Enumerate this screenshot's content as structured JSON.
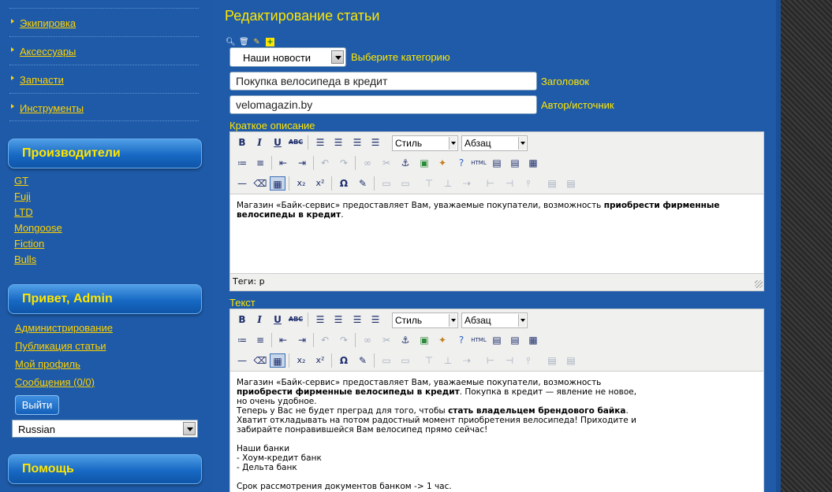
{
  "sidebar": {
    "categories": [
      "Экипировка",
      "Аксессуары",
      "Запчасти",
      "Инструменты"
    ],
    "makers_title": "Производители",
    "makers": [
      "GT",
      "Fuji",
      "LTD",
      "Mongoose",
      "Fiction",
      "Bulls"
    ],
    "greeting": "Привет, Admin",
    "admin_links": [
      "Администрирование",
      "Публикация статьи",
      "Мой профиль",
      "Сообщения (0/0)"
    ],
    "logout_label": "Выйти",
    "language": "Russian",
    "help_title": "Помощь"
  },
  "main": {
    "title": "Редактирование статьи",
    "category_value": "Наши новости",
    "category_label": "Выберите категорию",
    "headline_value": "Покупка велосипеда в кредит",
    "headline_label": "Заголовок",
    "author_value": "velomagazin.by",
    "author_label": "Автор/источник",
    "short_label": "Краткое описание",
    "text_label": "Текст",
    "style_select": "Стиль",
    "format_select": "Абзац",
    "status_tags": "Теги: p",
    "short_text_plain": "Магазин «Байк-сервис» предоставляет Вам, уважаемые покупатели, возможность ",
    "short_text_bold": "приобрести фирменные велосипеды в кредит",
    "short_text_end": ".",
    "body": {
      "p1_a": "Магазин «Байк-сервис» предоставляет Вам, уважаемые покупатели, возможность ",
      "p1_b": "приобрести фирменные велосипеды в кредит",
      "p1_c": ". Покупка в кредит — явление не новое, но очень удобное.",
      "p2_a": "Теперь у Вас не будет преград для того, чтобы ",
      "p2_b": "стать владельцем брендового байка",
      "p2_c": ".",
      "p3": "Хватит откладывать на потом радостный момент приобретения велосипеда! Приходите и забирайте понравившейся Вам велосипед прямо сейчас!",
      "banks_title": "Наши банки",
      "bank1": "- Хоум-кредит банк",
      "bank2": "- Дельта банк",
      "term": "Срок рассмотрения документов банком -> 1 час."
    }
  },
  "colors": {
    "background": "#1f5ba8",
    "accent": "#ffe600",
    "link": "#ffd200"
  },
  "icons": [
    "search-icon",
    "trash-icon",
    "pencil-icon",
    "add-icon",
    "bold-icon",
    "italic-icon",
    "underline-icon",
    "strike-icon",
    "align-left-icon",
    "align-center-icon",
    "align-right-icon",
    "justify-icon",
    "bullet-list-icon",
    "number-list-icon",
    "outdent-icon",
    "indent-icon",
    "undo-icon",
    "redo-icon",
    "link-icon",
    "unlink-icon",
    "anchor-icon",
    "image-icon",
    "cleanup-icon",
    "help-icon",
    "html-icon",
    "hr-icon",
    "eraser-icon",
    "table-icon",
    "subscript-icon",
    "superscript-icon",
    "omega-icon"
  ]
}
